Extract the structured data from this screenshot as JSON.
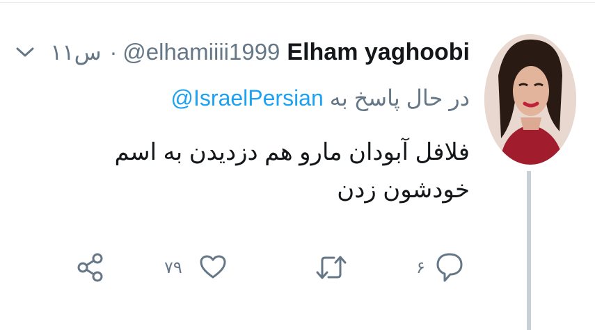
{
  "tweet": {
    "display_name": "Elham yaghoobi",
    "handle": "@elhamiiii1999",
    "separator": "·",
    "time": "۱۱س",
    "replying_prefix": "در حال پاسخ به",
    "replying_to": "@IsraelPersian",
    "text": "فلافل آبودان مارو هم دزدیدن به اسم خودشون زدن",
    "reply_count": "۶",
    "like_count": "۷۹"
  },
  "icons": {
    "caret": "chevron-down-icon",
    "reply": "reply-bubble-icon",
    "retweet": "retweet-icon",
    "like": "heart-icon",
    "share": "share-icon"
  },
  "colors": {
    "handle_gray": "#657786",
    "mention_blue": "#1da1f2",
    "thread_line": "#c8d1d8"
  }
}
